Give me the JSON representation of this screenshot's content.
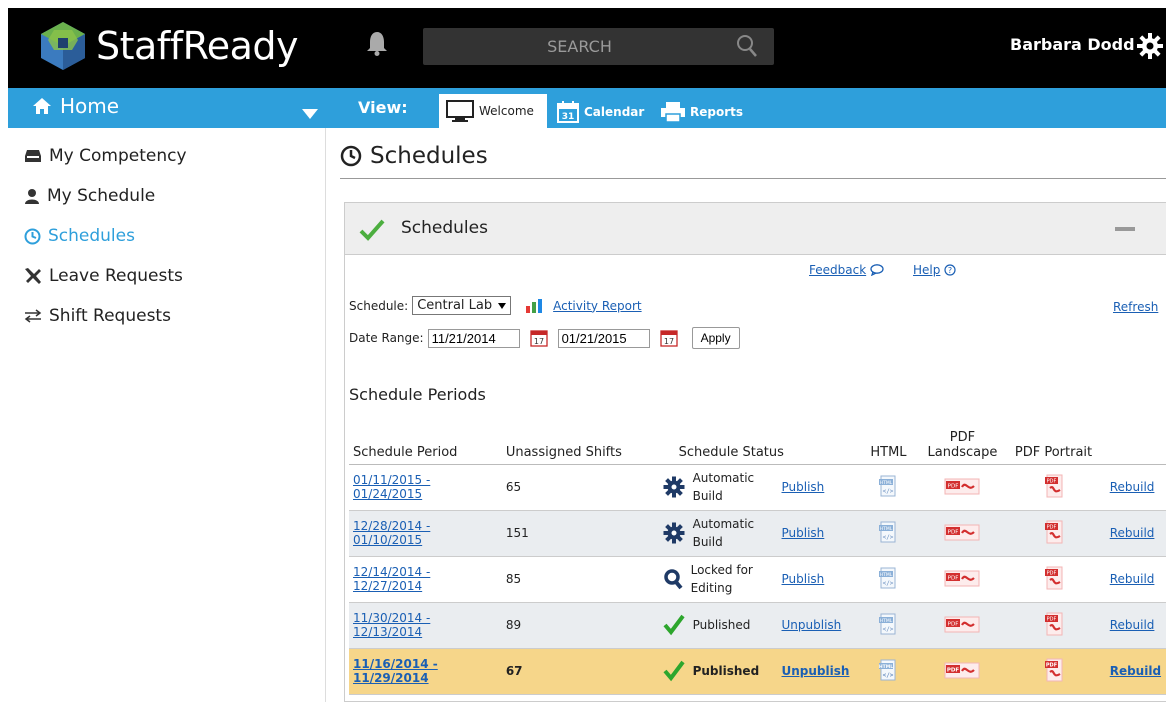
{
  "app": {
    "name": "StaffReady"
  },
  "search": {
    "placeholder": "SEARCH"
  },
  "user": {
    "name": "Barbara Dodd"
  },
  "nav": {
    "home": "Home",
    "view_label": "View:",
    "tabs": [
      {
        "label": "Welcome"
      },
      {
        "label": "Calendar"
      },
      {
        "label": "Reports"
      }
    ]
  },
  "sidebar": {
    "items": [
      {
        "label": "My Competency",
        "icon": "inbox-icon"
      },
      {
        "label": "My Schedule",
        "icon": "person-icon"
      },
      {
        "label": "Schedules",
        "icon": "clock-icon",
        "active": true
      },
      {
        "label": "Leave Requests",
        "icon": "plane-icon"
      },
      {
        "label": "Shift Requests",
        "icon": "swap-icon"
      }
    ]
  },
  "page": {
    "title": "Schedules"
  },
  "panel": {
    "title": "Schedules",
    "feedback": "Feedback",
    "help": "Help",
    "refresh": "Refresh",
    "schedule_label": "Schedule:",
    "schedule_value": "Central Lab",
    "activity_report": "Activity Report",
    "date_range_label": "Date Range:",
    "date_from": "11/21/2014",
    "date_to": "01/21/2015",
    "apply": "Apply",
    "periods_title": "Schedule Periods"
  },
  "table": {
    "headers": {
      "period": "Schedule Period",
      "unassigned": "Unassigned Shifts",
      "status": "Schedule Status",
      "html": "HTML",
      "pdf_landscape": "PDF Landscape",
      "pdf_portrait": "PDF Portrait"
    },
    "rows": [
      {
        "period_start": "01/11/2015 -",
        "period_end": "01/24/2015",
        "unassigned": "65",
        "status": "Automatic Build",
        "status_icon": "gear-icon",
        "action": "Publish",
        "rebuild": "Rebuild"
      },
      {
        "period_start": "12/28/2014 -",
        "period_end": "01/10/2015",
        "unassigned": "151",
        "status": "Automatic Build",
        "status_icon": "gear-icon",
        "action": "Publish",
        "rebuild": "Rebuild"
      },
      {
        "period_start": "12/14/2014 -",
        "period_end": "12/27/2014",
        "unassigned": "85",
        "status": "Locked for Editing",
        "status_icon": "magnifier-icon",
        "action": "Publish",
        "rebuild": "Rebuild"
      },
      {
        "period_start": "11/30/2014 -",
        "period_end": "12/13/2014",
        "unassigned": "89",
        "status": "Published",
        "status_icon": "checkmark-icon",
        "action": "Unpublish",
        "rebuild": "Rebuild"
      },
      {
        "period_start": "11/16/2014 -",
        "period_end": "11/29/2014",
        "unassigned": "67",
        "status": "Published",
        "status_icon": "checkmark-icon",
        "action": "Unpublish",
        "rebuild": "Rebuild"
      }
    ]
  },
  "colors": {
    "brand_blue": "#2e9fdb",
    "highlight_row": "#f6d68a",
    "check_green": "#3aa83a",
    "link": "#1a5fb4"
  }
}
